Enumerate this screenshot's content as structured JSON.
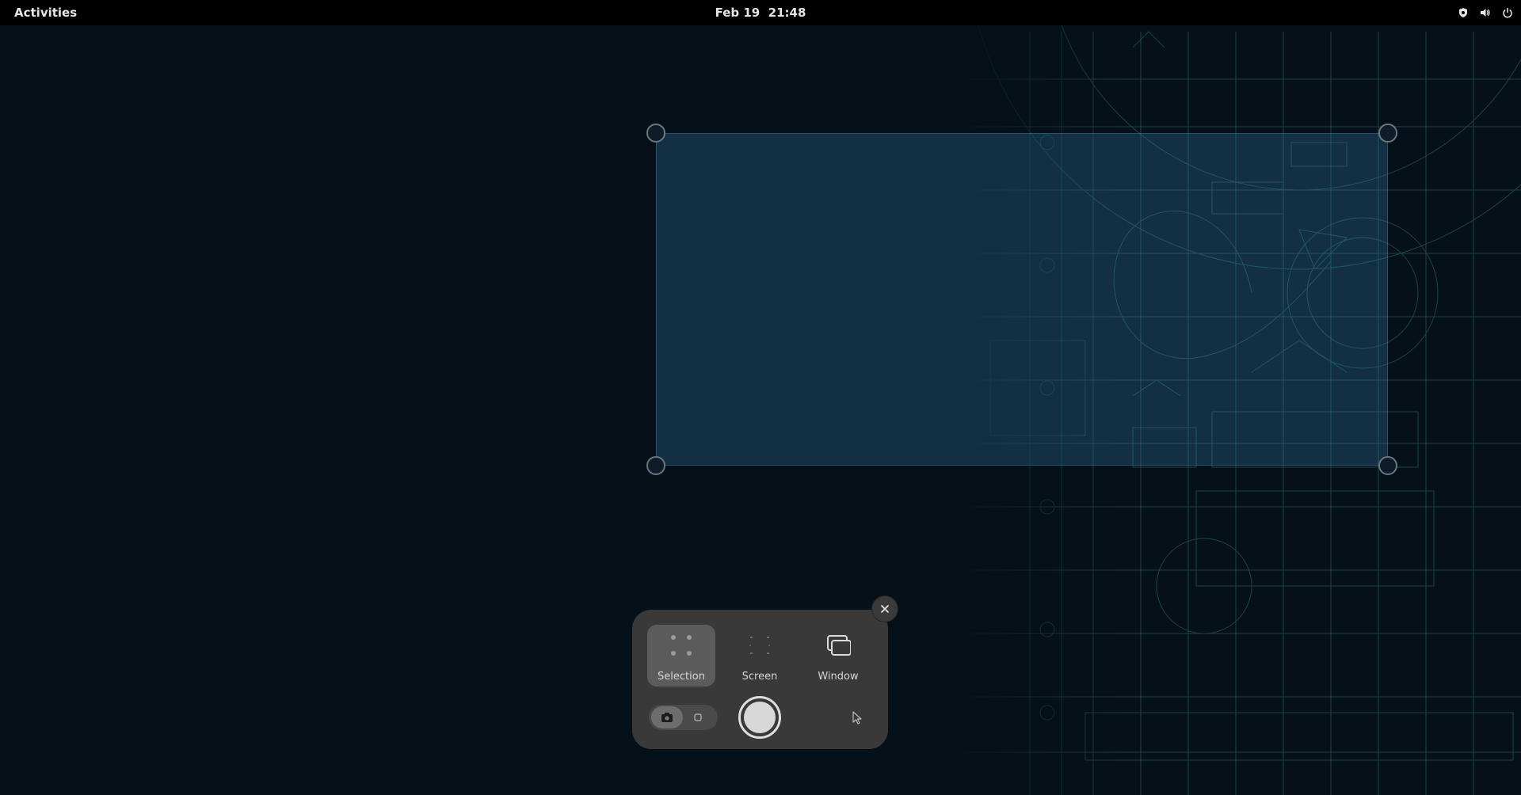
{
  "topbar": {
    "activities_label": "Activities",
    "clock_text": "Feb 19  21:48",
    "tray_icons": [
      "shield-icon",
      "volume-icon",
      "power-icon"
    ]
  },
  "screenshot_ui": {
    "modes": [
      {
        "label": "Selection",
        "icon": "selection-icon",
        "active": true
      },
      {
        "label": "Screen",
        "icon": "screen-icon",
        "active": false
      },
      {
        "label": "Window",
        "icon": "window-icon",
        "active": false
      }
    ],
    "capture_type": {
      "options": [
        "screenshot",
        "screencast"
      ],
      "selected": "screenshot"
    },
    "show_pointer": false,
    "close_icon": "close-icon",
    "capture_icon": "capture-icon",
    "pointer_icon": "pointer-icon"
  },
  "colors": {
    "topbar_bg": "#000000",
    "desktop_bg": "#061019",
    "panel_bg": "#393939",
    "selection_fill": "#388cbe",
    "wallpaper_lines": "#3c8c7a"
  }
}
